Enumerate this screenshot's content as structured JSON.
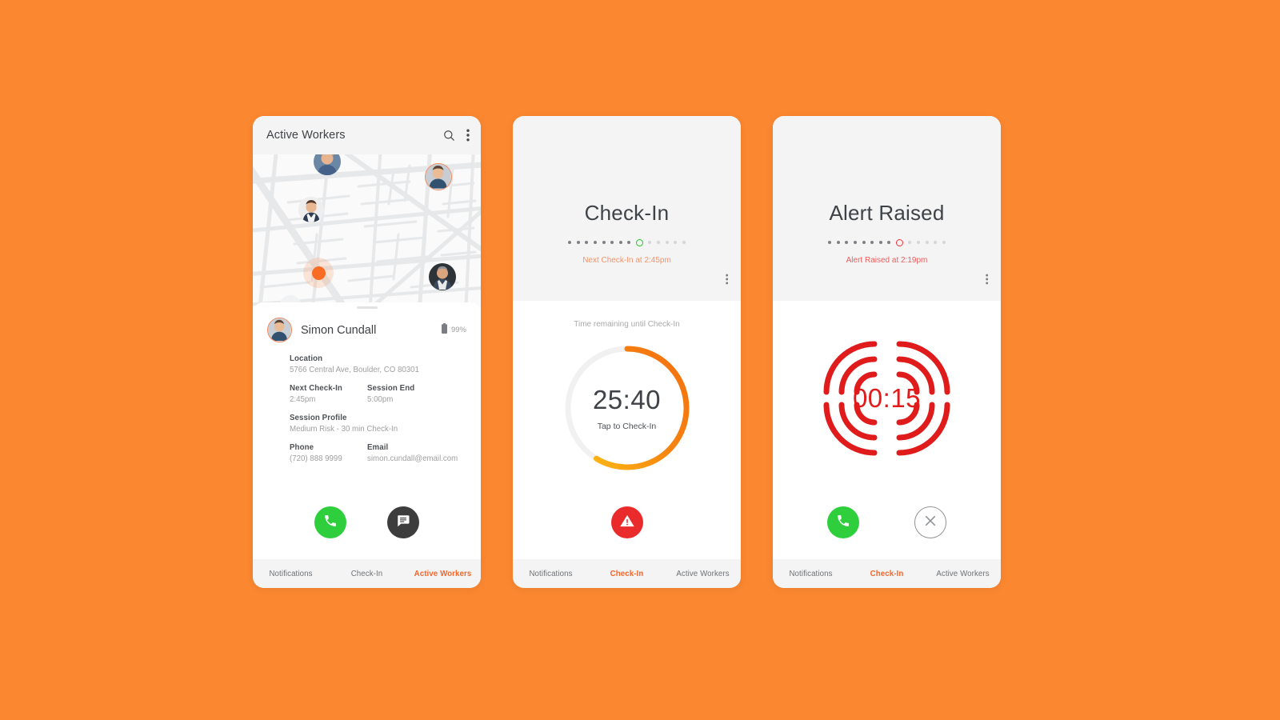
{
  "theme": {
    "background": "#fb8730",
    "accent_orange": "#f4662a",
    "green": "#2fce3c",
    "red": "#ea2b2b",
    "dark": "#3d3d3d"
  },
  "phone1": {
    "appbar": {
      "title": "Active Workers",
      "search_icon": "search-icon",
      "menu_icon": "overflow-menu-icon"
    },
    "map": {
      "self_marker": "current-location-dot",
      "workers": [
        "worker-avatar-1",
        "worker-avatar-2",
        "worker-avatar-3",
        "worker-avatar-4"
      ]
    },
    "card": {
      "name": "Simon Cundall",
      "battery_pct": "99%",
      "battery_icon": "battery-icon",
      "fields": {
        "location_label": "Location",
        "location_value": "5766 Central Ave, Boulder, CO 80301",
        "next_checkin_label": "Next Check-In",
        "next_checkin_value": "2:45pm",
        "session_end_label": "Session End",
        "session_end_value": "5:00pm",
        "session_profile_label": "Session Profile",
        "session_profile_value": "Medium Risk - 30 min Check-In",
        "phone_label": "Phone",
        "phone_value": "(720) 888 9999",
        "email_label": "Email",
        "email_value": "simon.cundall@email.com"
      },
      "call_button": "call-button",
      "message_button": "message-button"
    },
    "tabs": [
      {
        "label": "Notifications",
        "active": false
      },
      {
        "label": "Check-In",
        "active": false
      },
      {
        "label": "Active Workers",
        "active": true
      }
    ]
  },
  "phone2": {
    "title": "Check-In",
    "subtitle": "Next Check-In at 2:45pm",
    "progress_dots": {
      "past": 8,
      "future": 5,
      "current_color": "#1ec71e"
    },
    "menu_icon": "overflow-menu-icon",
    "timer_caption": "Time remaining until Check-In",
    "timer_value": "25:40",
    "timer_hint": "Tap to Check-In",
    "timer_arc_percent": 64,
    "alert_button": "raise-alert-button",
    "tabs": [
      {
        "label": "Notifications",
        "active": false
      },
      {
        "label": "Check-In",
        "active": true
      },
      {
        "label": "Active Workers",
        "active": false
      }
    ]
  },
  "phone3": {
    "title": "Alert Raised",
    "subtitle": "Alert Raised at 2:19pm",
    "progress_dots": {
      "past": 8,
      "future": 5,
      "current_color": "#ef2f33"
    },
    "menu_icon": "overflow-menu-icon",
    "alert_time": "00:15",
    "call_button": "call-button",
    "cancel_button": "cancel-alert-button",
    "tabs": [
      {
        "label": "Notifications",
        "active": false
      },
      {
        "label": "Check-In",
        "active": true
      },
      {
        "label": "Active Workers",
        "active": false
      }
    ]
  }
}
